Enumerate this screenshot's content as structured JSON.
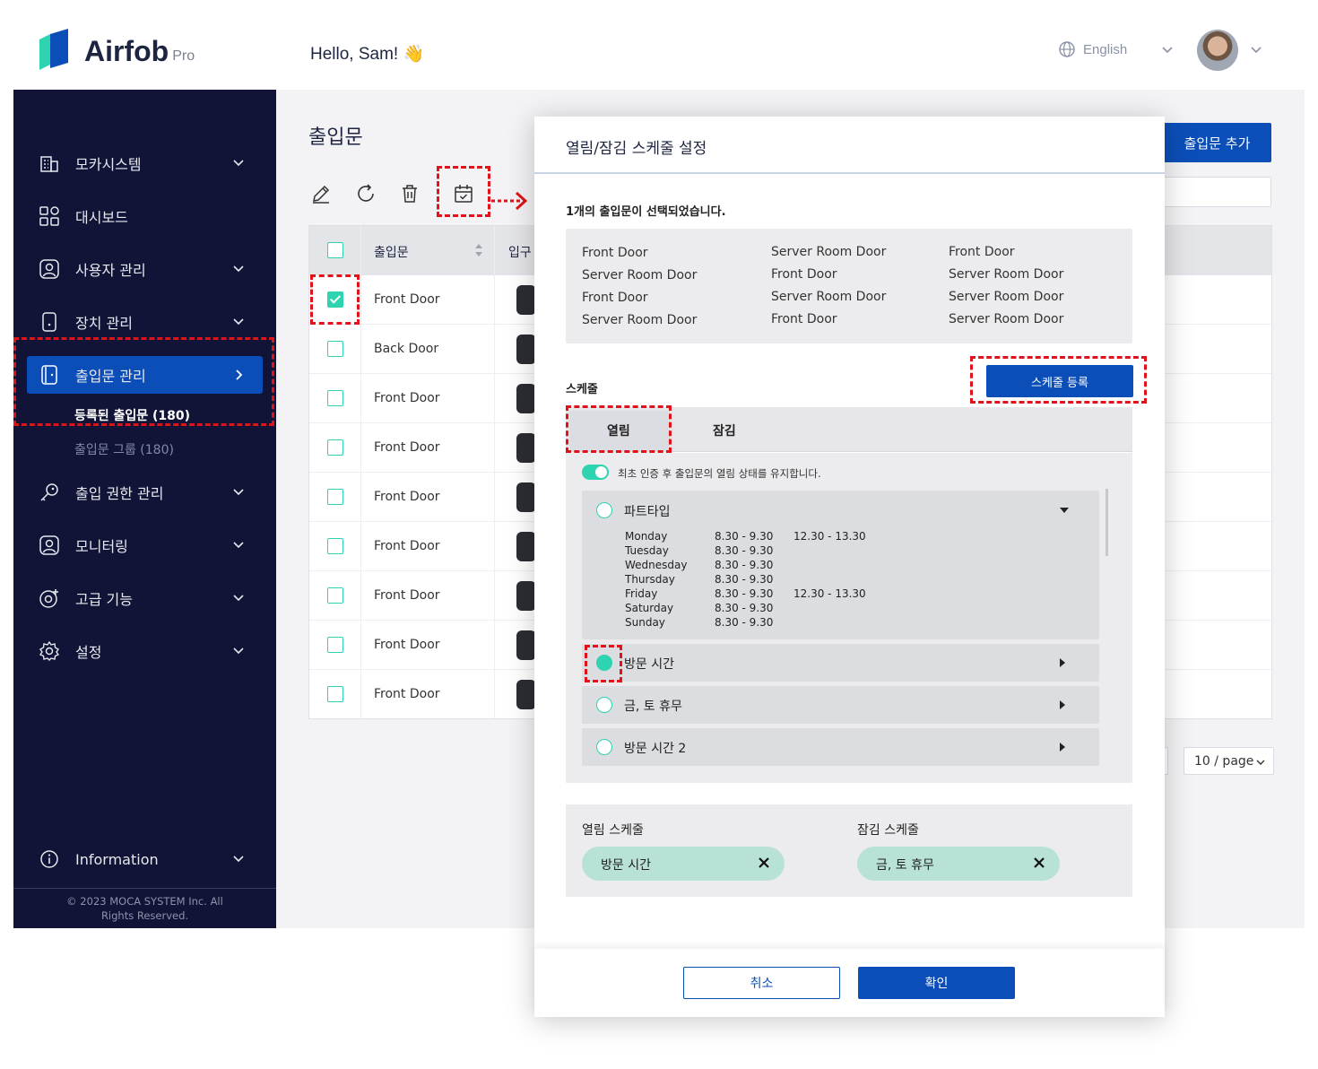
{
  "header": {
    "logo_text": "Airfob",
    "logo_sub": "Pro",
    "greeting": "Hello, Sam! 👋",
    "language": "English"
  },
  "sidebar": {
    "items": [
      {
        "label": "모카시스템",
        "icon": "building-icon"
      },
      {
        "label": "대시보드",
        "icon": "dashboard-icon"
      },
      {
        "label": "사용자 관리",
        "icon": "user-icon"
      },
      {
        "label": "장치 관리",
        "icon": "device-icon"
      },
      {
        "label": "출입문 관리",
        "icon": "door-icon"
      },
      {
        "label": "출입 권한 관리",
        "icon": "key-icon"
      },
      {
        "label": "모니터링",
        "icon": "monitor-icon"
      },
      {
        "label": "고급 기능",
        "icon": "advanced-icon"
      },
      {
        "label": "설정",
        "icon": "gear-icon"
      },
      {
        "label": "Information",
        "icon": "info-icon"
      }
    ],
    "sub_items": [
      "등록된 출입문  (180)",
      "출입문 그룹  (180)"
    ],
    "copyright": "© 2023 MOCA SYSTEM Inc. All Rights Reserved."
  },
  "main": {
    "title": "출입문",
    "add_button": "출입문 추가",
    "columns": [
      "출입문",
      "입구"
    ],
    "rows": [
      {
        "name": "Front Door",
        "checked": true
      },
      {
        "name": "Back Door",
        "checked": false
      },
      {
        "name": "Front Door",
        "checked": false
      },
      {
        "name": "Front Door",
        "checked": false
      },
      {
        "name": "Front Door",
        "checked": false
      },
      {
        "name": "Front Door",
        "checked": false
      },
      {
        "name": "Front Door",
        "checked": false
      },
      {
        "name": "Front Door",
        "checked": false
      },
      {
        "name": "Front Door",
        "checked": false
      }
    ],
    "page_size": "10 / page"
  },
  "modal": {
    "title": "열림/잠김 스케줄 설정",
    "selected_text": "1개의 출입문이 선택되었습니다.",
    "doors": [
      [
        "Front Door",
        "Server Room Door",
        "Front Door",
        "Server Room Door"
      ],
      [
        "Server Room Door",
        "Front Door",
        "Server Room Door",
        "Front Door"
      ],
      [
        "Front Door",
        "Server Room Door",
        "Server Room Door",
        "Server Room Door"
      ]
    ],
    "schedule_label": "스케줄",
    "register_button": "스케줄 등록",
    "tabs": [
      "열림",
      "잠김"
    ],
    "toggle_text": "최초 인증 후 출입문의 열림 상태를 유지합니다.",
    "schedules": [
      {
        "name": "파트타입",
        "expanded": true,
        "selected": false
      },
      {
        "name": "방문 시간",
        "expanded": false,
        "selected": true
      },
      {
        "name": "금, 토 휴무",
        "expanded": false,
        "selected": false
      },
      {
        "name": "방문 시간 2",
        "expanded": false,
        "selected": false
      }
    ],
    "parttime_detail": [
      {
        "day": "Monday",
        "t1": "8.30 - 9.30",
        "t2": "12.30 - 13.30"
      },
      {
        "day": "Tuesday",
        "t1": "8.30 - 9.30",
        "t2": ""
      },
      {
        "day": "Wednesday",
        "t1": "8.30 - 9.30",
        "t2": ""
      },
      {
        "day": "Thursday",
        "t1": "8.30 - 9.30",
        "t2": ""
      },
      {
        "day": "Friday",
        "t1": "8.30 - 9.30",
        "t2": "12.30 - 13.30"
      },
      {
        "day": "Saturday",
        "t1": "8.30 - 9.30",
        "t2": ""
      },
      {
        "day": "Sunday",
        "t1": "8.30 - 9.30",
        "t2": ""
      }
    ],
    "open_schedule_label": "열림 스케줄",
    "lock_schedule_label": "잠김 스케줄",
    "open_chip": "방문 시간",
    "lock_chip": "금, 토 휴무",
    "cancel": "취소",
    "confirm": "확인"
  },
  "colors": {
    "navy": "#111436",
    "primary": "#0c4eb8",
    "accent": "#2ed3b0",
    "annotation": "#e0121a"
  }
}
